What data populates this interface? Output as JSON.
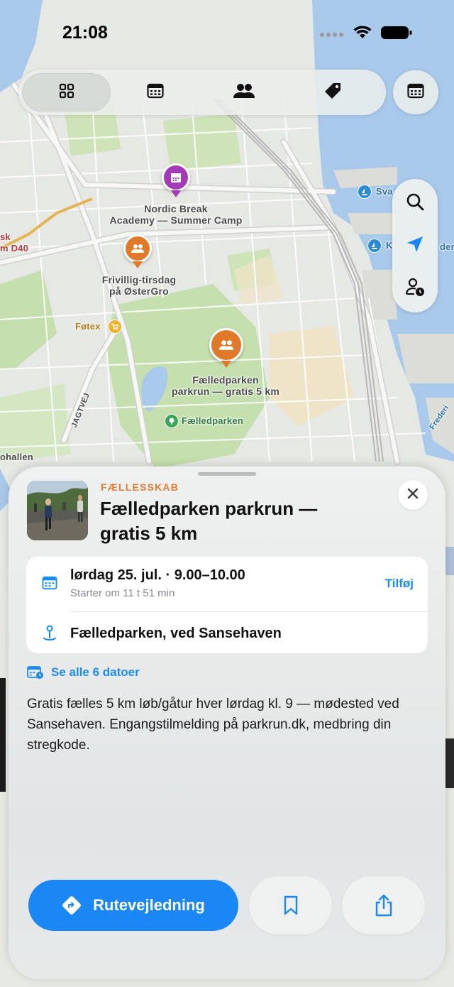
{
  "status_bar": {
    "time": "21:08"
  },
  "toolbar": {
    "tabs": [
      {
        "icon": "grid-icon",
        "active": true
      },
      {
        "icon": "calendar-icon",
        "active": false
      },
      {
        "icon": "people-icon",
        "active": false
      },
      {
        "icon": "tag-icon",
        "active": false
      }
    ],
    "calendar_button_icon": "calendar-icon"
  },
  "map_controls": [
    "search-icon",
    "location-arrow-icon",
    "person-clock-icon"
  ],
  "map": {
    "pins": [
      {
        "label": "Nordic Break\nAcademy — Summer Camp",
        "icon": "calendar-icon",
        "color": "#a23bb5"
      },
      {
        "label": "Frivillig-tirsdag\npå ØsterGro",
        "icon": "people-icon",
        "color": "#e07a2a"
      },
      {
        "label": "Fælledparken\nparkrun — gratis 5 km",
        "icon": "people-icon",
        "color": "#e07a2a"
      }
    ],
    "labels": {
      "fotex": "Føtex",
      "faelledparken": "Fælledparken",
      "sk": "sk",
      "d40": "m D40",
      "ohallen": "ohallen",
      "jagtvej": "JAGTVEJ",
      "sva": "Sva",
      "k": "K",
      "deri": "deri",
      "frederi": "Frederi"
    }
  },
  "sheet": {
    "category": "FÆLLESSKAB",
    "title": "Fælledparken parkrun — gratis 5 km",
    "date": "lørdag 25. jul. · 9.00–10.00",
    "starts_in": "Starter om 11 t 51 min",
    "add_label": "Tilføj",
    "location": "Fælledparken, ved Sansehaven",
    "see_all": "Se alle 6 datoer",
    "description": "Gratis fælles 5 km løb/gåtur hver lørdag kl. 9 — mødested ved Sansehaven. Engangstilmelding på parkrun.dk, medbring din stregkode.",
    "directions_label": "Rutevejledning",
    "accent": "#1b87f5",
    "category_color": "#e57c2f"
  }
}
